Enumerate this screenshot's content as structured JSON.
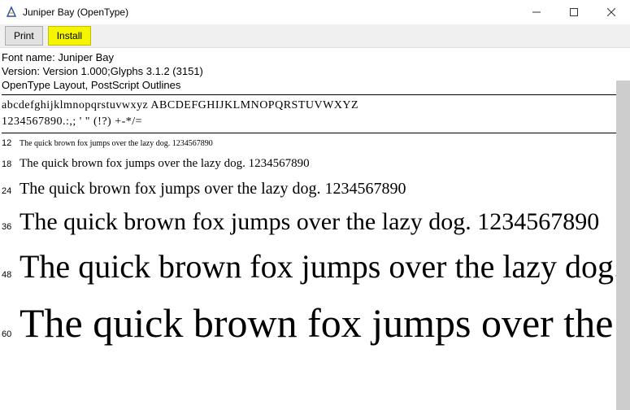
{
  "titlebar": {
    "title": "Juniper Bay (OpenType)"
  },
  "toolbar": {
    "print_label": "Print",
    "install_label": "Install"
  },
  "meta": {
    "font_name_line": "Font name: Juniper Bay",
    "version_line": "Version: Version 1.000;Glyphs 3.1.2 (3151)",
    "layout_line": "OpenType Layout, PostScript Outlines"
  },
  "charset": {
    "line1": "abcdefghijklmnopqrstuvwxyz ABCDEFGHIJKLMNOPQRSTUVWXYZ",
    "line2": "1234567890.:,; ' \" (!?) +-*/="
  },
  "waterfall": {
    "sample_text": "The quick brown fox jumps over the lazy dog. 1234567890",
    "sizes": [
      {
        "pt": "12",
        "class": "s12"
      },
      {
        "pt": "18",
        "class": "s18"
      },
      {
        "pt": "24",
        "class": "s24"
      },
      {
        "pt": "36",
        "class": "s36"
      },
      {
        "pt": "48",
        "class": "s48"
      },
      {
        "pt": "60",
        "class": "s60"
      }
    ]
  }
}
